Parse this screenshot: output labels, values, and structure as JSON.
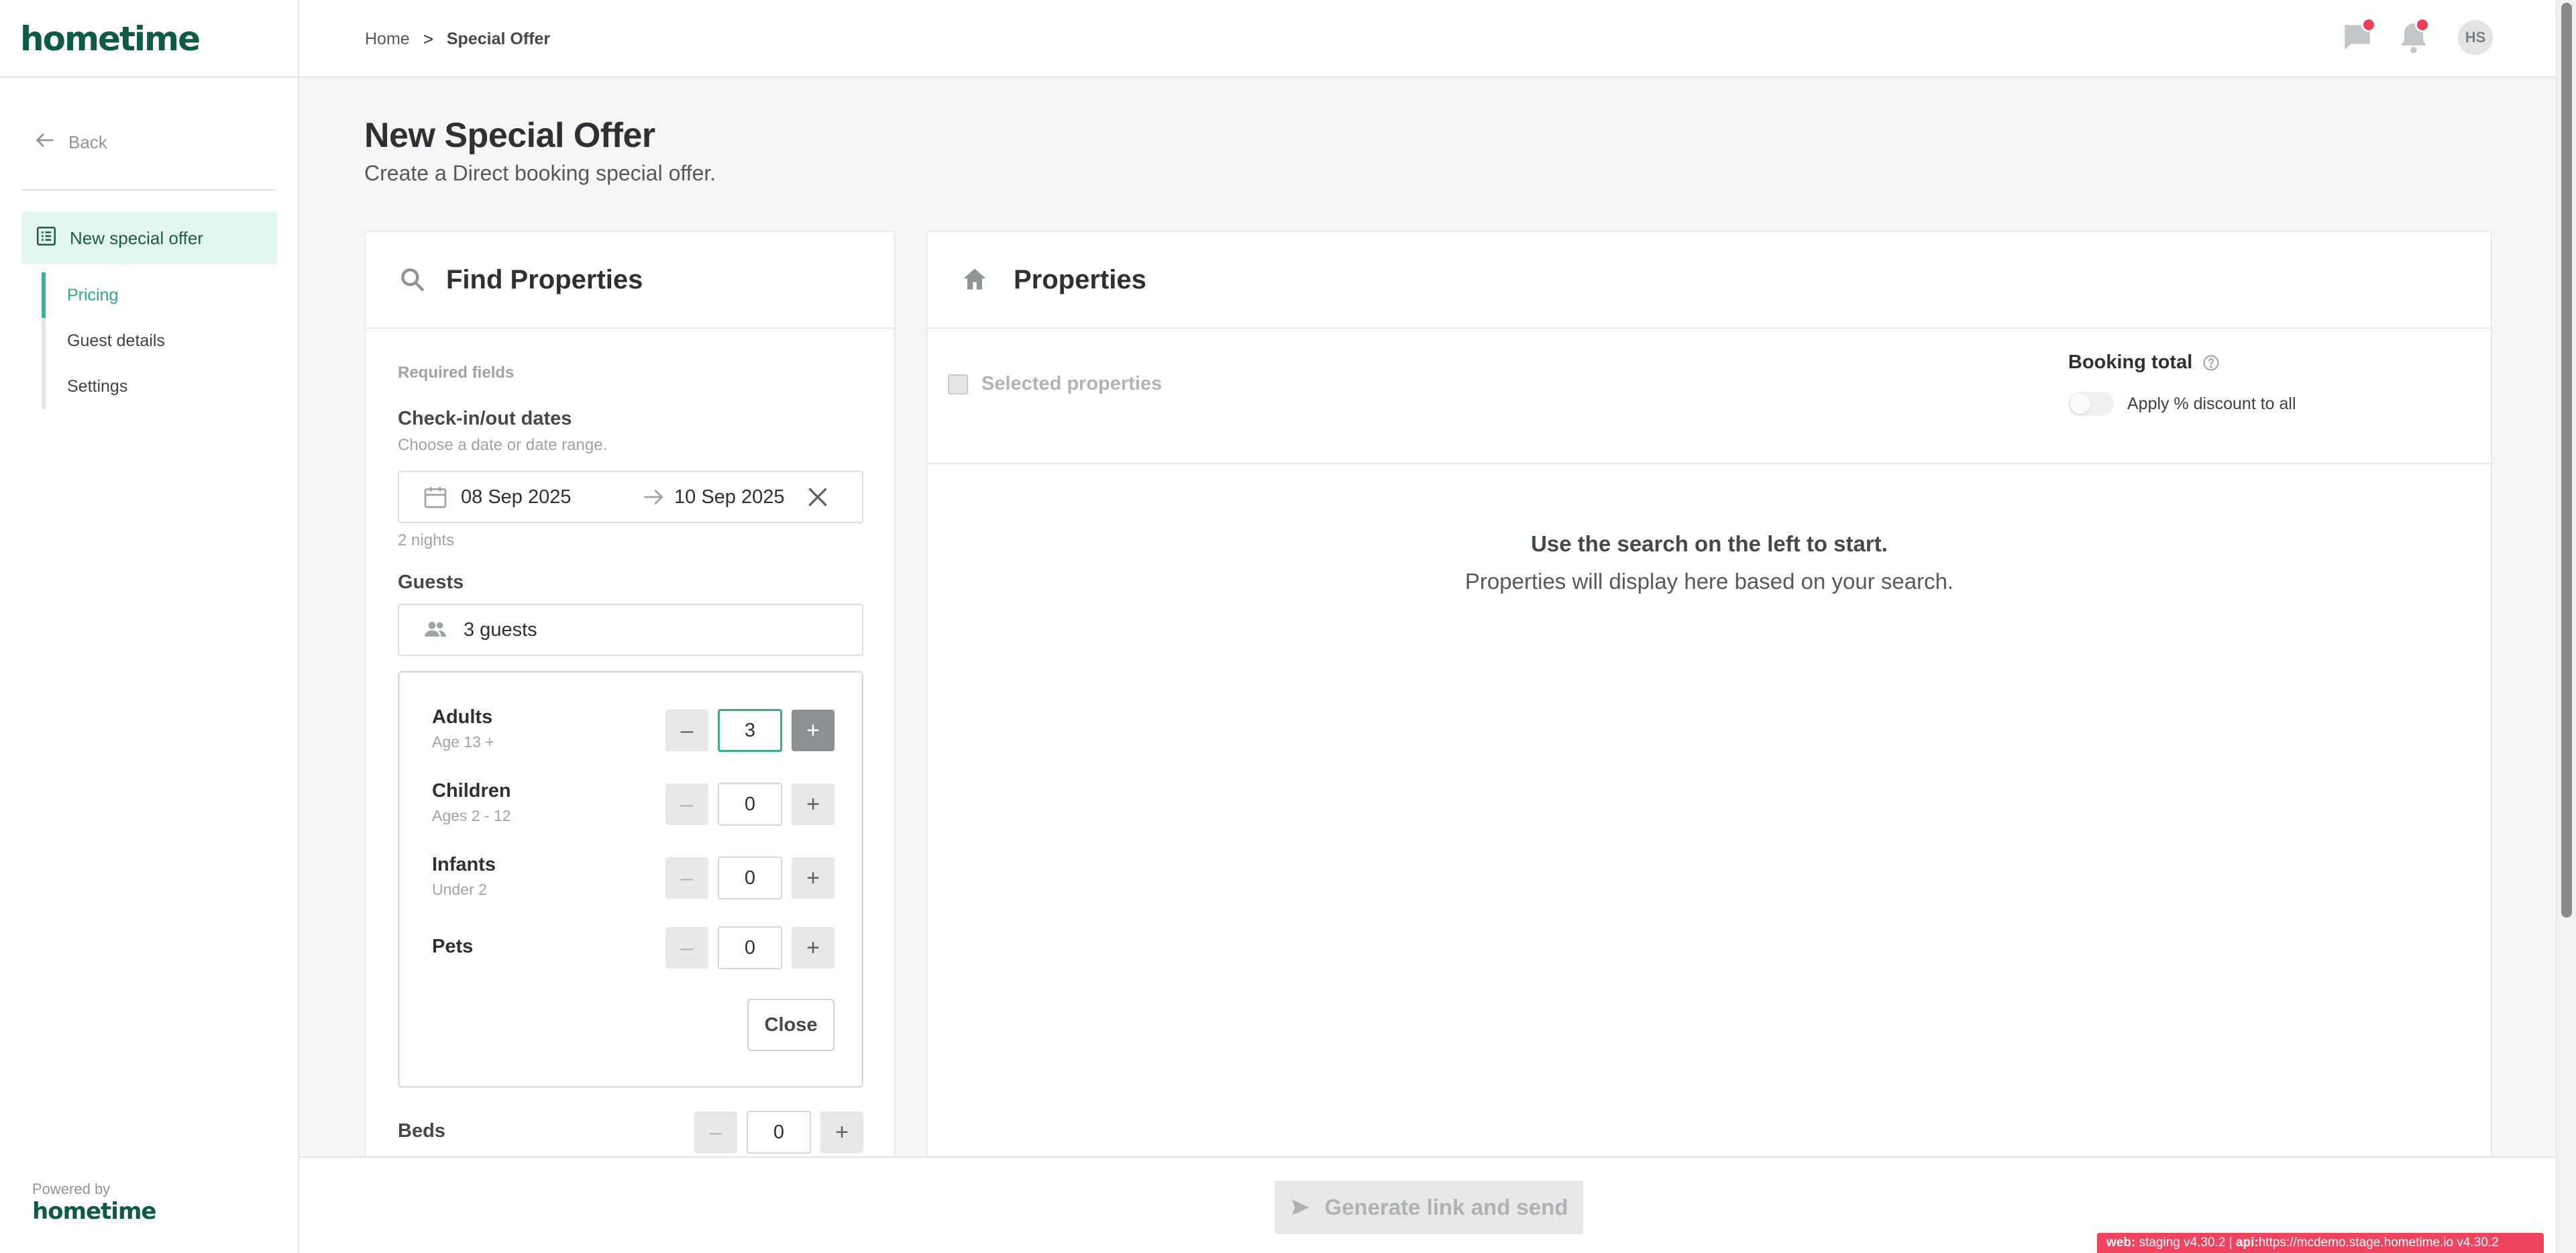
{
  "app": {
    "logo": "hometime",
    "powered_by": "Powered by",
    "powered_logo": "hometime"
  },
  "sidebar": {
    "back_label": "Back",
    "active_item": "New special offer",
    "sub_items": [
      {
        "label": "Pricing",
        "active": true
      },
      {
        "label": "Guest details",
        "active": false
      },
      {
        "label": "Settings",
        "active": false
      }
    ]
  },
  "header": {
    "breadcrumb": {
      "home": "Home",
      "separator": ">",
      "current": "Special Offer"
    },
    "avatar_initials": "HS",
    "icons": [
      "chat-icon",
      "bell-icon"
    ],
    "notification_color": "#ee3b56"
  },
  "page": {
    "title": "New Special Offer",
    "subtitle": "Create a Direct booking special offer."
  },
  "find": {
    "title": "Find Properties",
    "required_label": "Required fields",
    "dates": {
      "label": "Check-in/out dates",
      "help": "Choose a date or date range.",
      "checkin": "08 Sep 2025",
      "checkout": "10 Sep 2025",
      "nights": "2 nights"
    },
    "guests": {
      "label": "Guests",
      "summary": "3 guests",
      "rows": [
        {
          "name": "Adults",
          "sub": "Age 13 +",
          "value": "3"
        },
        {
          "name": "Children",
          "sub": "Ages 2 - 12",
          "value": "0"
        },
        {
          "name": "Infants",
          "sub": "Under 2",
          "value": "0"
        },
        {
          "name": "Pets",
          "sub": "",
          "value": "0"
        }
      ],
      "minus": "–",
      "plus": "+",
      "close_label": "Close"
    },
    "beds": {
      "label": "Beds",
      "value": "0"
    }
  },
  "properties": {
    "title": "Properties",
    "selected_label": "Selected properties",
    "booking_total_label": "Booking total",
    "discount_label": "Apply % discount to all",
    "empty_title": "Use the search on the left to start.",
    "empty_sub": "Properties will display here based on your search."
  },
  "footer": {
    "generate_label": "Generate link and send"
  },
  "version": {
    "web_label": "web:",
    "web_value": "staging v4.30.2 |",
    "api_label": "api:",
    "api_value": "https://mcdemo.stage.hometime.io v4.30.2"
  },
  "colors": {
    "brand": "#0e5a47",
    "accent": "#39b593",
    "active_bg": "#e2f6ee"
  }
}
